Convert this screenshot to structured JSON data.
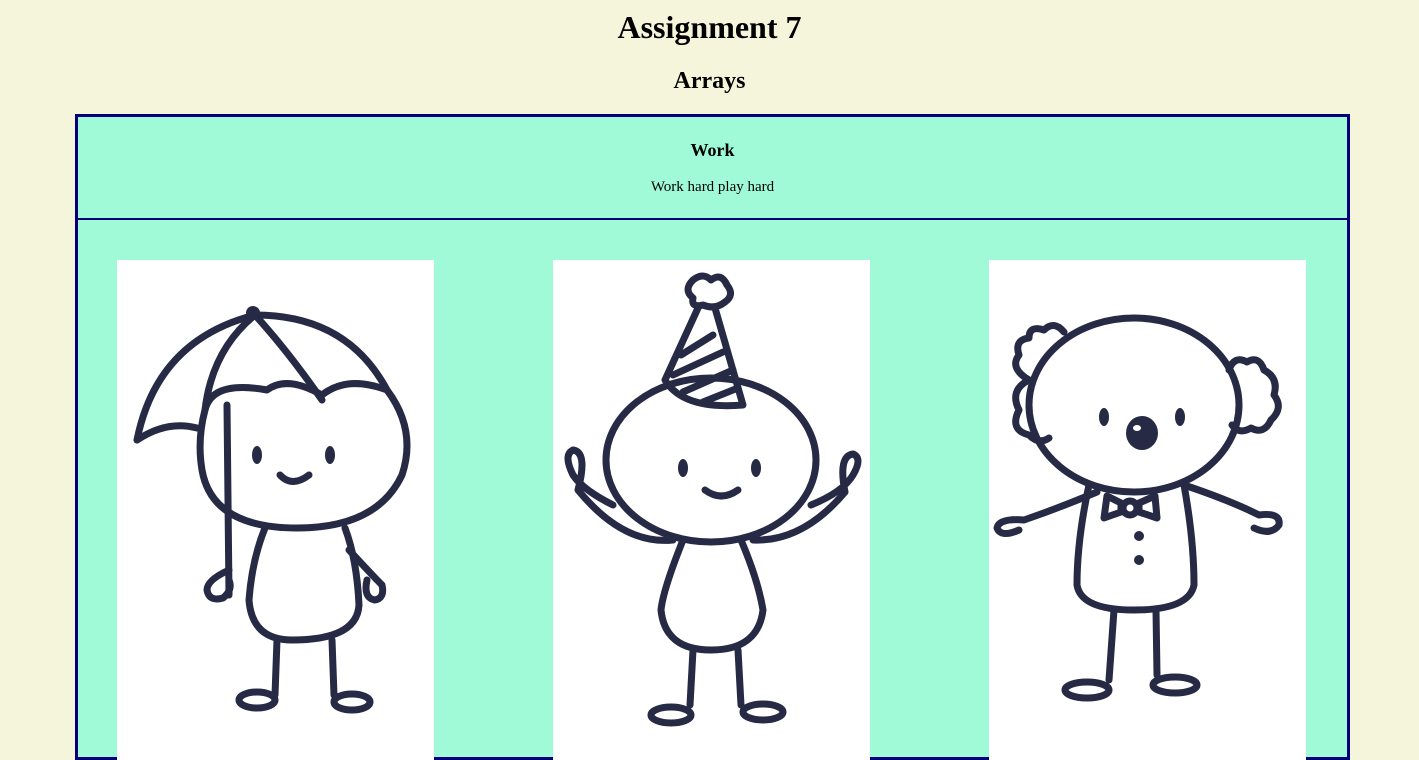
{
  "page": {
    "title": "Assignment 7",
    "subtitle": "Arrays"
  },
  "header": {
    "title": "Work",
    "text": "Work hard play hard"
  },
  "gallery": {
    "images": [
      {
        "icon": "stick-figure-umbrella"
      },
      {
        "icon": "stick-figure-party-hat"
      },
      {
        "icon": "stick-figure-clown"
      }
    ]
  },
  "colors": {
    "background": "#f5f5dc",
    "panel": "#a0fad8",
    "border": "#00007a",
    "ink": "#262a44"
  }
}
